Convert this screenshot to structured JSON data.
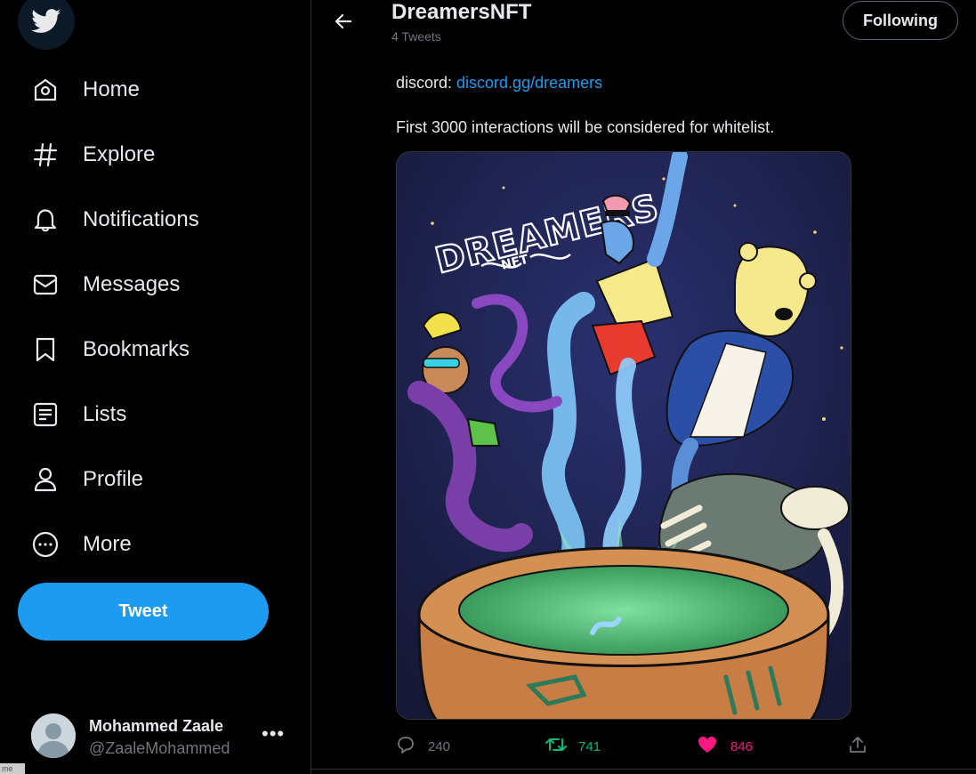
{
  "sidebar": {
    "logo_icon": "twitter-bird-icon",
    "items": [
      {
        "label": "Home",
        "icon": "home-icon"
      },
      {
        "label": "Explore",
        "icon": "hashtag-icon"
      },
      {
        "label": "Notifications",
        "icon": "bell-icon"
      },
      {
        "label": "Messages",
        "icon": "envelope-icon"
      },
      {
        "label": "Bookmarks",
        "icon": "bookmark-icon"
      },
      {
        "label": "Lists",
        "icon": "list-icon"
      },
      {
        "label": "Profile",
        "icon": "person-icon"
      },
      {
        "label": "More",
        "icon": "more-circle-icon"
      }
    ],
    "tweet_label": "Tweet",
    "account": {
      "name": "Mohammed Zaale",
      "handle": "@ZaaleMohammed",
      "more": "•••"
    },
    "corner_tag": "me"
  },
  "header": {
    "title": "DreamersNFT",
    "subtitle": "4 Tweets",
    "follow_label": "Following"
  },
  "tweet": {
    "discord_prefix": "discord: ",
    "discord_link": "discord.gg/dreamers",
    "body": "First 3000 interactions will be considered for whitelist.",
    "image_text": {
      "title": "DREAMERS",
      "subtitle": "NFT"
    },
    "actions": {
      "replies": "240",
      "retweets": "741",
      "likes": "846"
    }
  },
  "colors": {
    "accent": "#1d9bf0",
    "retweet": "#00ba7c",
    "like": "#f91880",
    "muted": "#71767b"
  }
}
